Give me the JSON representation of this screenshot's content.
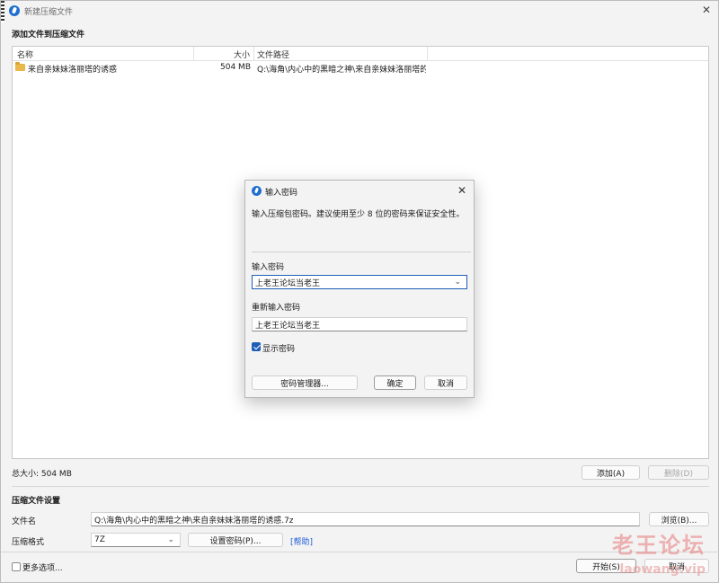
{
  "window": {
    "title": "新建压缩文件"
  },
  "files_section": {
    "heading": "添加文件到压缩文件",
    "columns": {
      "name": "名称",
      "size": "大小",
      "path": "文件路径"
    },
    "rows": [
      {
        "name": "来自亲妹妹洛丽塔的诱惑",
        "size": "504 MB",
        "path": "Q:\\海角\\内心中的黑暗之神\\来自亲妹妹洛丽塔的诱..."
      }
    ],
    "total": "总大小: 504 MB",
    "add_label": "添加(A)",
    "delete_label": "删除(D)"
  },
  "settings": {
    "heading": "压缩文件设置",
    "filename_label": "文件名",
    "filename_value": "Q:\\海角\\内心中的黑暗之神\\来自亲妹妹洛丽塔的诱惑.7z",
    "browse_label": "浏览(B)...",
    "format_label": "压缩格式",
    "format_value": "7Z",
    "set_password_label": "设置密码(P)...",
    "help_label": "[帮助]",
    "more_options_label": "更多选项...",
    "start_label": "开始(S)",
    "cancel_label": "取消"
  },
  "dialog": {
    "title": "输入密码",
    "hint": "输入压缩包密码。建议使用至少 8 位的密码来保证安全性。",
    "password_label": "输入密码",
    "password_value": "上老王论坛当老王",
    "reenter_label": "重新输入密码",
    "reenter_value": "上老王论坛当老王",
    "show_password_label": "显示密码",
    "show_password_checked": true,
    "manager_label": "密码管理器...",
    "ok_label": "确定",
    "cancel_label": "取消"
  },
  "watermark": {
    "main": "老王论坛",
    "sub": "laowang.vip"
  },
  "colors": {
    "accent": "#1f5fb8",
    "link": "#1f5bd8",
    "folder": "#e8b84a"
  }
}
